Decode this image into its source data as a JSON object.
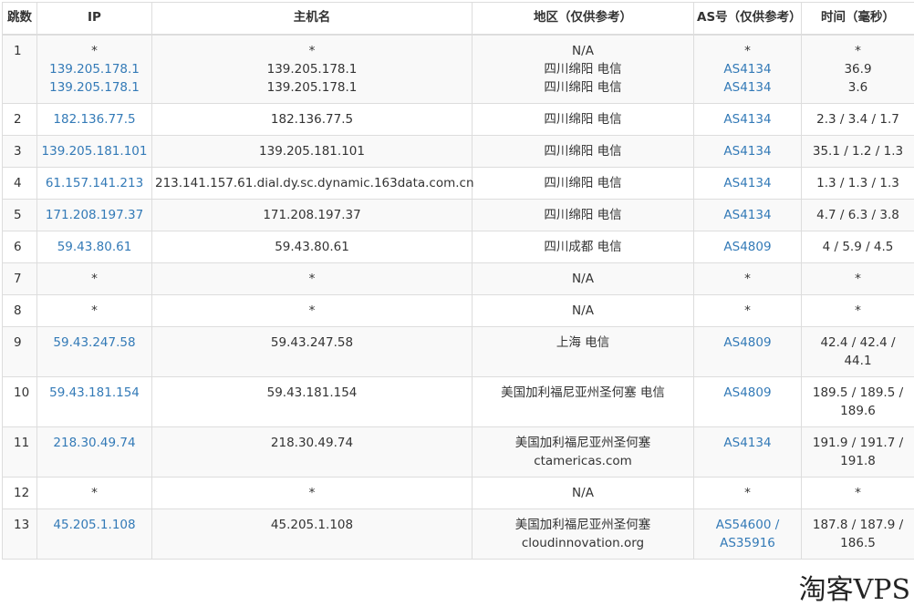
{
  "headers": {
    "hop": "跳数",
    "ip": "IP",
    "host": "主机名",
    "region": "地区（仅供参考）",
    "as": "AS号（仅供参考）",
    "time": "时间（毫秒）"
  },
  "rows": [
    {
      "hop": "1",
      "ip": [
        "*",
        "139.205.178.1",
        "139.205.178.1"
      ],
      "host": [
        "*",
        "139.205.178.1",
        "139.205.178.1"
      ],
      "region": [
        "N/A",
        "四川绵阳 电信",
        "四川绵阳 电信"
      ],
      "as": [
        "*",
        "AS4134",
        "AS4134"
      ],
      "time": [
        "*",
        "36.9",
        "3.6"
      ]
    },
    {
      "hop": "2",
      "ip": [
        "182.136.77.5"
      ],
      "host": [
        "182.136.77.5"
      ],
      "region": [
        "四川绵阳 电信"
      ],
      "as": [
        "AS4134"
      ],
      "time": [
        "2.3 / 3.4 / 1.7"
      ]
    },
    {
      "hop": "3",
      "ip": [
        "139.205.181.101"
      ],
      "host": [
        "139.205.181.101"
      ],
      "region": [
        "四川绵阳 电信"
      ],
      "as": [
        "AS4134"
      ],
      "time": [
        "35.1 / 1.2 / 1.3"
      ]
    },
    {
      "hop": "4",
      "ip": [
        "61.157.141.213"
      ],
      "host": [
        "213.141.157.61.dial.dy.sc.dynamic.163data.com.cn"
      ],
      "region": [
        "四川绵阳 电信"
      ],
      "as": [
        "AS4134"
      ],
      "time": [
        "1.3 / 1.3 / 1.3"
      ]
    },
    {
      "hop": "5",
      "ip": [
        "171.208.197.37"
      ],
      "host": [
        "171.208.197.37"
      ],
      "region": [
        "四川绵阳 电信"
      ],
      "as": [
        "AS4134"
      ],
      "time": [
        "4.7 / 6.3 / 3.8"
      ]
    },
    {
      "hop": "6",
      "ip": [
        "59.43.80.61"
      ],
      "host": [
        "59.43.80.61"
      ],
      "region": [
        "四川成都 电信"
      ],
      "as": [
        "AS4809"
      ],
      "time": [
        "4 / 5.9 / 4.5"
      ]
    },
    {
      "hop": "7",
      "ip": [
        "*"
      ],
      "host": [
        "*"
      ],
      "region": [
        "N/A"
      ],
      "as": [
        "*"
      ],
      "time": [
        "*"
      ]
    },
    {
      "hop": "8",
      "ip": [
        "*"
      ],
      "host": [
        "*"
      ],
      "region": [
        "N/A"
      ],
      "as": [
        "*"
      ],
      "time": [
        "*"
      ]
    },
    {
      "hop": "9",
      "ip": [
        "59.43.247.58"
      ],
      "host": [
        "59.43.247.58"
      ],
      "region": [
        "上海 电信"
      ],
      "as": [
        "AS4809"
      ],
      "time": [
        "42.4 / 42.4 /",
        "44.1"
      ]
    },
    {
      "hop": "10",
      "ip": [
        "59.43.181.154"
      ],
      "host": [
        "59.43.181.154"
      ],
      "region": [
        "美国加利福尼亚州圣何塞 电信"
      ],
      "as": [
        "AS4809"
      ],
      "time": [
        "189.5 / 189.5 /",
        "189.6"
      ]
    },
    {
      "hop": "11",
      "ip": [
        "218.30.49.74"
      ],
      "host": [
        "218.30.49.74"
      ],
      "region": [
        "美国加利福尼亚州圣何塞",
        "ctamericas.com"
      ],
      "as": [
        "AS4134"
      ],
      "time": [
        "191.9 / 191.7 /",
        "191.8"
      ]
    },
    {
      "hop": "12",
      "ip": [
        "*"
      ],
      "host": [
        "*"
      ],
      "region": [
        "N/A"
      ],
      "as": [
        "*"
      ],
      "time": [
        "*"
      ]
    },
    {
      "hop": "13",
      "ip": [
        "45.205.1.108"
      ],
      "host": [
        "45.205.1.108"
      ],
      "region": [
        "美国加利福尼亚州圣何塞",
        "cloudinnovation.org"
      ],
      "as": [
        "AS54600 /",
        "AS35916"
      ],
      "time": [
        "187.8 / 187.9 /",
        "186.5"
      ]
    }
  ],
  "watermark": "淘客VPS"
}
